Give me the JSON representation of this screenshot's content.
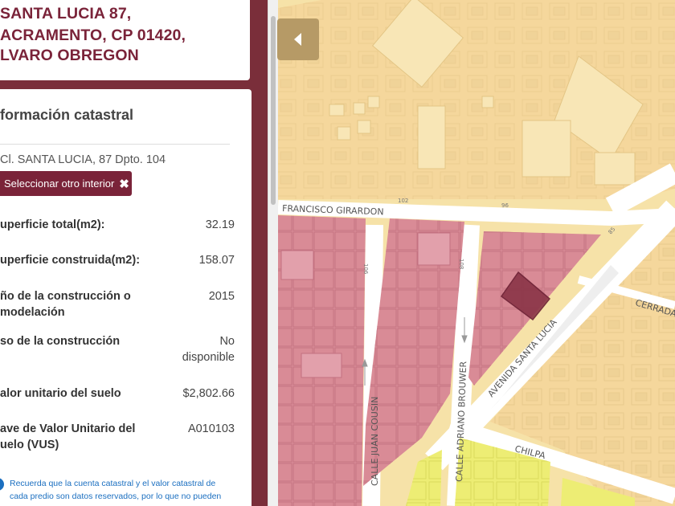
{
  "address": {
    "line1": "SANTA LUCIA 87,",
    "line2": "ACRAMENTO, CP 01420,",
    "line3": "LVARO OBREGON"
  },
  "info": {
    "title": "formación catastral",
    "interior": "Cl. SANTA LUCIA, 87 Dpto. 104",
    "select_button": "Seleccionar otro interior",
    "rows": [
      {
        "label": "uperficie total(m2):",
        "value": "32.19"
      },
      {
        "label": "uperficie construida(m2):",
        "value": "158.07"
      },
      {
        "label1": "ño de la construcción o",
        "label2": "modelación",
        "value": "2015"
      },
      {
        "label": "so de la construcción",
        "value1": "No",
        "value2": "disponible"
      },
      {
        "label": "alor unitario del suelo",
        "value": "$2,802.66"
      },
      {
        "label1": "ave de Valor Unitario del",
        "label2": "uelo (VUS)",
        "value": "A010103"
      }
    ],
    "note_line1": "Recuerda que la cuenta catastral y el valor catastral de",
    "note_line2": "cada predio son datos reservados, por lo que no pueden"
  },
  "map": {
    "streets": {
      "francisco_girardon": "FRANCISCO GIRARDON",
      "avenida_santa_lucia": "AVENIDA SANTA LUCIA",
      "calle_juan_cousin": "CALLE JUAN COUSIN",
      "calle_adriano_brouwer": "CALLE ADRIANO BROUWER",
      "chilpa": "CHILPA",
      "cerrada": "CERRADA"
    },
    "numbers": {
      "n102": "102",
      "n96": "96",
      "n85": "85",
      "n108": "108",
      "n106": "106"
    },
    "colors": {
      "background": "#f6e2a8",
      "building_yellow": "#f5d79c",
      "block_pink": "#d98b96",
      "block_yellow": "#eded74",
      "selected": "#8a3447",
      "road": "#ffffff"
    }
  }
}
